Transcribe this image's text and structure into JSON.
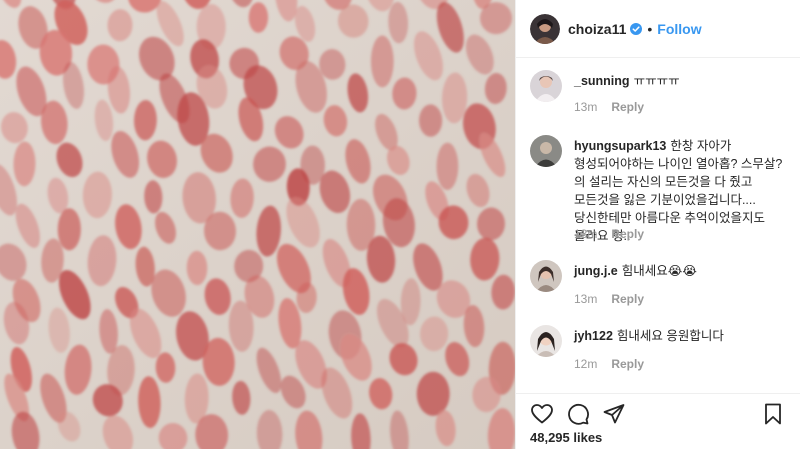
{
  "header": {
    "username": "choiza11",
    "separator": "•",
    "follow_label": "Follow"
  },
  "comments": [
    {
      "username": "_sunning",
      "text": "ㅠㅠㅠㅠ",
      "time": "13m",
      "reply": "Reply"
    },
    {
      "username": "hyungsupark13",
      "text": "한창 자아가 형성되어야하는 나이인 열아홉? 스무살?의 설리는 자신의 모든것을 다 줬고 모든것을 잃은 기분이었을겁니다.... 당신한테만 아름다운 추억이었을지도 몰라요 형..",
      "time": "13m",
      "reply": "Reply"
    },
    {
      "username": "jung.j.e",
      "text": "힘내세요😭😭",
      "time": "13m",
      "reply": "Reply"
    },
    {
      "username": "jyh122",
      "text": "힘내세요 응원합니다",
      "time": "12m",
      "reply": "Reply"
    }
  ],
  "actions": {
    "like_icon": "heart-icon",
    "comment_icon": "comment-icon",
    "share_icon": "share-icon",
    "save_icon": "bookmark-icon"
  },
  "likes": "48,295 likes",
  "colors": {
    "accent": "#3897f0",
    "text": "#262626",
    "muted": "#999999",
    "wall": "#ddd3cc",
    "lipstick": "#c9514f"
  }
}
